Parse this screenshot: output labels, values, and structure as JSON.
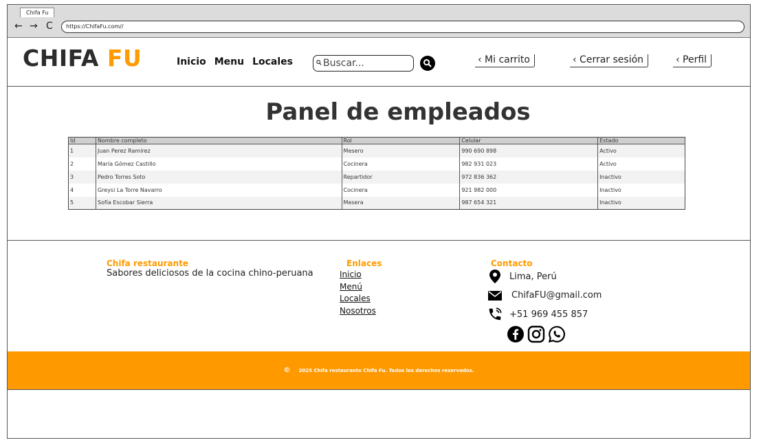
{
  "browser": {
    "tab_title": "Chifa Fu",
    "url": "https://ChifaFu.com//",
    "back": "←",
    "forward": "→",
    "reload": "C"
  },
  "header": {
    "logo_part1": "CHIFA",
    "logo_part2": "FU",
    "nav": [
      "Inicio",
      "Menu",
      "Locales"
    ],
    "search_placeholder": "Buscar...",
    "cart_label": "‹ Mi carrito",
    "logout_label": "‹ Cerrar sesión",
    "profile_label": "‹ Perfil"
  },
  "main": {
    "title": "Panel de empleados",
    "table": {
      "columns": [
        "Id",
        "Nombre completo",
        "Rol",
        "Celular",
        "Estado"
      ],
      "rows": [
        [
          "1",
          "Juan Perez Ramirez",
          "Mesero",
          "990 690 898",
          "Activo"
        ],
        [
          "2",
          "María Gómez Castillo",
          "Cocinera",
          "982 931 023",
          "Activo"
        ],
        [
          "3",
          "Pedro Torres Soto",
          "Repartidor",
          "972 836 362",
          "Inactivo"
        ],
        [
          "4",
          "Greysi La Torre Navarro",
          "Cocinera",
          "921 982 000",
          "Inactivo"
        ],
        [
          "5",
          "Sofía Escobar Sierra",
          "Mesera",
          "987 654 321",
          "Inactivo"
        ]
      ]
    }
  },
  "footer": {
    "about_title": "Chifa restaurante",
    "about_text": "Sabores deliciosos de la cocina chino-peruana",
    "links_title": "Enlaces",
    "links": [
      "Inicio",
      "Menú",
      "Locales",
      "Nosotros"
    ],
    "contact_title": "Contacto",
    "location": "Lima, Perú",
    "email": "ChifaFU@gmail.com",
    "phone": "+51 969 455 857",
    "social_icons": [
      "facebook-icon",
      "instagram-icon",
      "whatsapp-icon"
    ],
    "copyright_symbol": "©",
    "copyright": "2025 Chifa restaurante Chifa Fu. Todos los derechos reservados."
  },
  "colors": {
    "accent": "#ff9b00",
    "footer_bar": "#ff9900",
    "table_header": "#cfcfcf"
  }
}
